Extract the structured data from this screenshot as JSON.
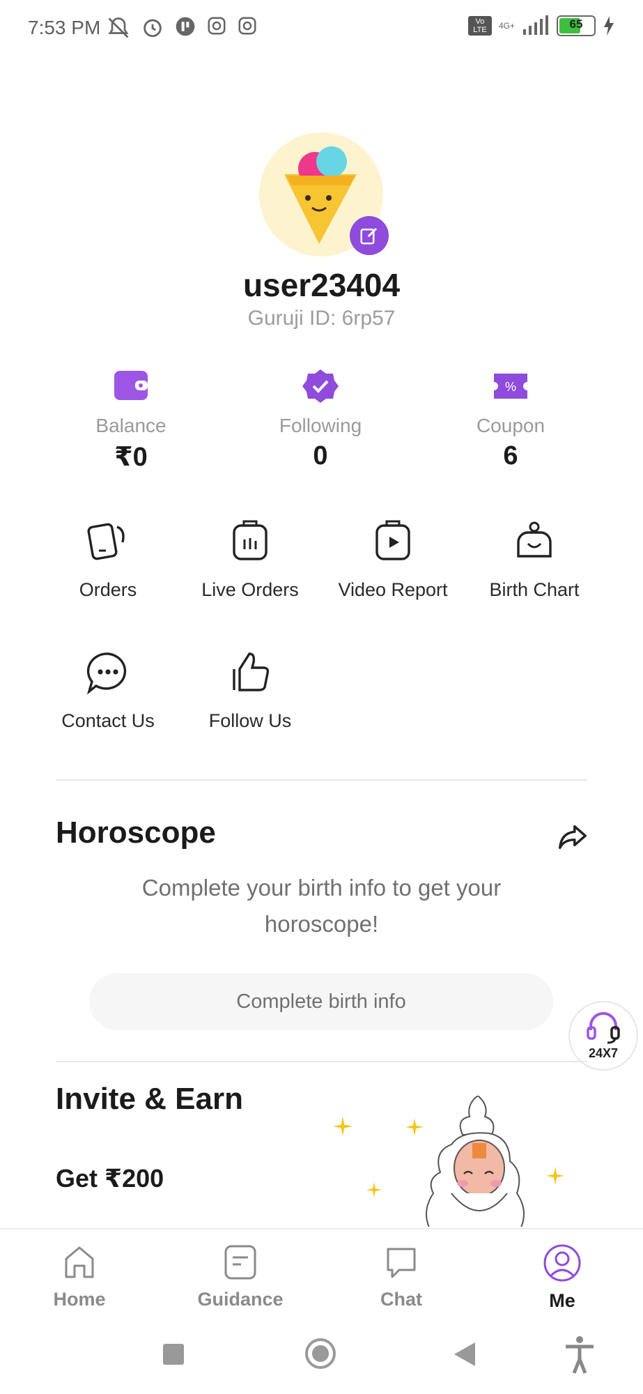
{
  "status_bar": {
    "time": "7:53 PM",
    "battery": "65",
    "network": "4G+",
    "volte": "Vo LTE",
    "icons": [
      "mute-icon",
      "alarm-icon",
      "app-icon",
      "instagram-icon",
      "instagram-icon"
    ]
  },
  "profile": {
    "username": "user23404",
    "guruji_id": "Guruji ID: 6rp57"
  },
  "stats": [
    {
      "label": "Balance",
      "value": "₹0",
      "icon": "wallet-icon"
    },
    {
      "label": "Following",
      "value": "0",
      "icon": "verified-badge-icon"
    },
    {
      "label": "Coupon",
      "value": "6",
      "icon": "coupon-icon"
    }
  ],
  "menu": [
    {
      "label": "Orders",
      "icon": "orders-icon"
    },
    {
      "label": "Live Orders",
      "icon": "live-orders-icon"
    },
    {
      "label": "Video Report",
      "icon": "video-report-icon"
    },
    {
      "label": "Birth Chart",
      "icon": "birth-chart-icon"
    },
    {
      "label": "Contact Us",
      "icon": "chat-bubble-icon"
    },
    {
      "label": "Follow Us",
      "icon": "thumbs-up-icon"
    }
  ],
  "horoscope": {
    "title": "Horoscope",
    "description": "Complete your birth info to get your horoscope!",
    "button": "Complete birth info"
  },
  "support": {
    "label": "24X7"
  },
  "invite": {
    "title": "Invite & Earn",
    "reward": "Get ₹200"
  },
  "bottom_nav": [
    {
      "label": "Home",
      "icon": "home-icon"
    },
    {
      "label": "Guidance",
      "icon": "guidance-icon"
    },
    {
      "label": "Chat",
      "icon": "chat-icon"
    },
    {
      "label": "Me",
      "icon": "profile-icon",
      "active": true
    }
  ],
  "colors": {
    "accent": "#8e4bdc",
    "star": "#f5c518"
  }
}
